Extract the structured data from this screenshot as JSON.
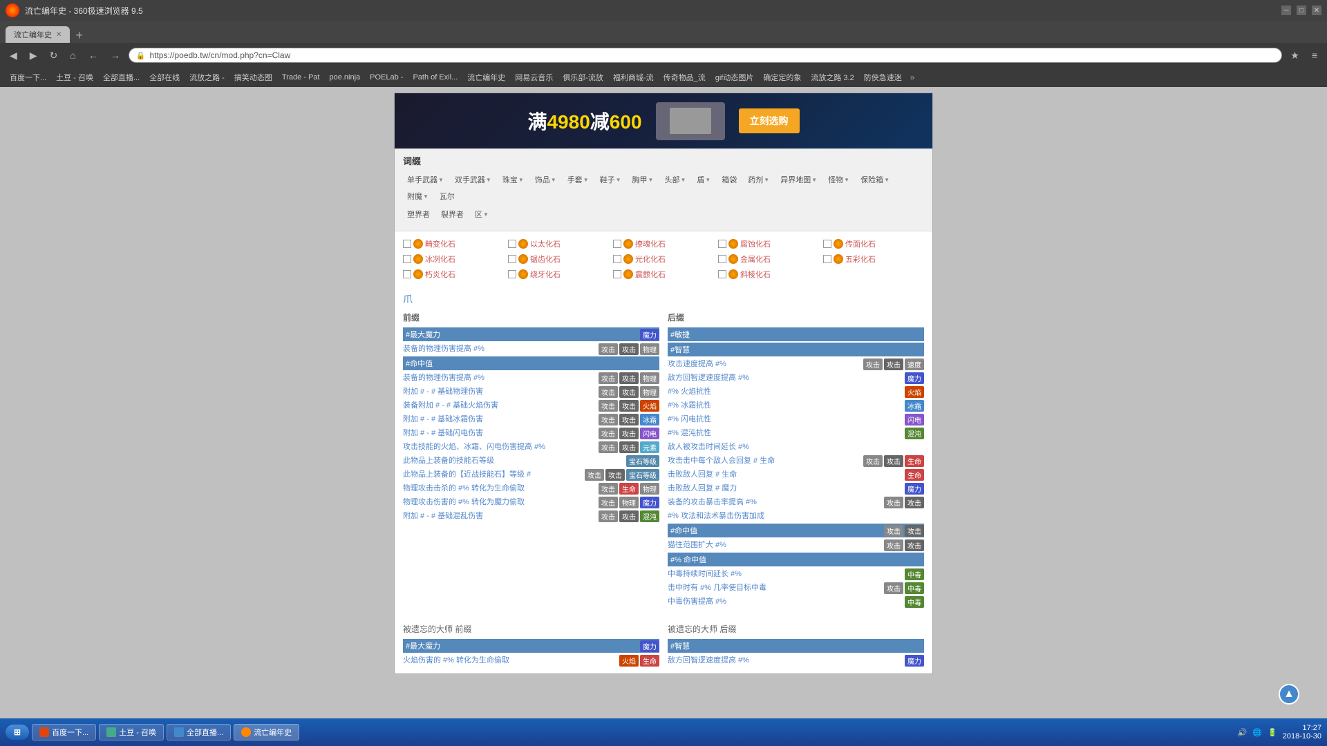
{
  "browser": {
    "title": "流亡编年史 - 360极速浏览器 9.5",
    "url": "https://poedb.tw/cn/mod.php?cn=Claw",
    "tab_label": "流亡编年史",
    "nav_buttons": [
      "◀",
      "▶",
      "↻",
      "⌂",
      "←",
      "→",
      "★"
    ],
    "bookmarks": [
      "百度一下...",
      "土豆 - 召唤",
      "全部直播...",
      "全部在线",
      "流放之路 -",
      "搞笑动态图",
      "Trade - Pat",
      "poe.ninja",
      "POELab -",
      "Path of Exil...",
      "流亡编年史",
      "网易云音乐",
      "俱乐部-流放",
      "福利商城-流",
      "传奇物品_流",
      "gif动态图片",
      "确定定的象",
      "流放之路 3.2",
      "防侠急速迷"
    ]
  },
  "banner": {
    "text": "满4980减600",
    "button": "立刻选购"
  },
  "menu": {
    "title": "词缀",
    "items_row1": [
      {
        "label": "单手武器",
        "has_dropdown": true
      },
      {
        "label": "双手武器",
        "has_dropdown": true
      },
      {
        "label": "珠宝",
        "has_dropdown": true
      },
      {
        "label": "饰品",
        "has_dropdown": true
      },
      {
        "label": "手套",
        "has_dropdown": true
      },
      {
        "label": "鞋子",
        "has_dropdown": true
      },
      {
        "label": "胸甲",
        "has_dropdown": true
      },
      {
        "label": "头部",
        "has_dropdown": true
      },
      {
        "label": "盾",
        "has_dropdown": true
      },
      {
        "label": "箱袋",
        "has_dropdown": false
      },
      {
        "label": "药剂",
        "has_dropdown": true
      },
      {
        "label": "异界地图",
        "has_dropdown": true
      },
      {
        "label": "怪物",
        "has_dropdown": true
      },
      {
        "label": "保险箱",
        "has_dropdown": true
      },
      {
        "label": "附魔",
        "has_dropdown": true
      },
      {
        "label": "瓦尔",
        "has_dropdown": false
      }
    ],
    "items_row2": [
      {
        "label": "塑界者",
        "has_dropdown": false
      },
      {
        "label": "裂界者",
        "has_dropdown": false
      },
      {
        "label": "区",
        "has_dropdown": true
      }
    ]
  },
  "gems": [
    {
      "name": "畸变化石",
      "color": "orange"
    },
    {
      "name": "以太化石",
      "color": "orange"
    },
    {
      "name": "撩魂化石",
      "color": "orange"
    },
    {
      "name": "腐蚀化石",
      "color": "orange"
    },
    {
      "name": "传面化石",
      "color": "orange"
    },
    {
      "name": "冰冽化石",
      "color": "orange"
    },
    {
      "name": "锯齿化石",
      "color": "orange"
    },
    {
      "name": "光化化石",
      "color": "orange"
    },
    {
      "name": "金属化石",
      "color": "orange"
    },
    {
      "name": "五彩化石",
      "color": "orange"
    },
    {
      "name": "朽炎化石",
      "color": "orange"
    },
    {
      "name": "绕牙化石",
      "color": "orange"
    },
    {
      "name": "震颤化石",
      "color": "orange"
    },
    {
      "name": "斜棱化石",
      "color": "orange"
    }
  ],
  "claw_icon": "爪",
  "prefix_title": "前缀",
  "suffix_title": "后缀",
  "prefix_rows": [
    {
      "label": "#最大魔力",
      "tags": [
        {
          "text": "魔力",
          "type": "mana"
        }
      ],
      "highlight": true
    },
    {
      "label": "装备的物理伤害提高 #%",
      "tags": [
        {
          "text": "攻击",
          "type": "atk"
        },
        {
          "text": "攻击",
          "type": "atk2"
        },
        {
          "text": "物理",
          "type": "phys"
        }
      ]
    },
    {
      "label": "#命中值",
      "tags": [],
      "highlight": true
    },
    {
      "label": "装备的物理伤害提高 #%",
      "tags": [
        {
          "text": "攻击",
          "type": "atk"
        },
        {
          "text": "攻击",
          "type": "atk2"
        },
        {
          "text": "物理",
          "type": "phys"
        }
      ]
    },
    {
      "label": "附加 # - # 基础物理伤害",
      "tags": [
        {
          "text": "攻击",
          "type": "atk"
        },
        {
          "text": "攻击",
          "type": "atk2"
        },
        {
          "text": "物理",
          "type": "phys"
        }
      ]
    },
    {
      "label": "装备附加 # - # 基础火焰伤害",
      "tags": [
        {
          "text": "攻击",
          "type": "atk"
        },
        {
          "text": "攻击",
          "type": "atk2"
        },
        {
          "text": "火焰",
          "type": "fire"
        }
      ]
    },
    {
      "label": "附加 # - # 基础冰霜伤害",
      "tags": [
        {
          "text": "攻击",
          "type": "atk"
        },
        {
          "text": "攻击",
          "type": "atk2"
        },
        {
          "text": "冰霜",
          "type": "ice"
        }
      ]
    },
    {
      "label": "附加 # - # 基础闪电伤害",
      "tags": [
        {
          "text": "攻击",
          "type": "atk"
        },
        {
          "text": "攻击",
          "type": "atk2"
        },
        {
          "text": "闪电",
          "type": "lightning"
        }
      ]
    },
    {
      "label": "攻击技能的火焰、冰霜、闪电伤害提高 #%",
      "tags": [
        {
          "text": "攻击",
          "type": "atk"
        },
        {
          "text": "攻击",
          "type": "atk2"
        },
        {
          "text": "元素",
          "type": "elem"
        }
      ]
    },
    {
      "label": "此物品上装备的技能石等级",
      "tags": [
        {
          "text": "宝石等级",
          "type": "gem"
        }
      ]
    },
    {
      "label": "此物品上装备的【近战技能石】等级 #",
      "tags": [
        {
          "text": "攻击",
          "type": "atk"
        },
        {
          "text": "攻击",
          "type": "atk2"
        },
        {
          "text": "宝石等级",
          "type": "gem"
        }
      ]
    },
    {
      "label": "物理攻击击杀的 #% 转化为生命偷取",
      "tags": [
        {
          "text": "攻击",
          "type": "atk"
        },
        {
          "text": "生命",
          "type": "life"
        },
        {
          "text": "物理",
          "type": "phys"
        }
      ]
    },
    {
      "label": "物理攻击伤害的 #% 转化为魔力偷取",
      "tags": [
        {
          "text": "攻击",
          "type": "atk"
        },
        {
          "text": "物理",
          "type": "phys"
        },
        {
          "text": "魔力",
          "type": "mana"
        }
      ]
    },
    {
      "label": "附加 # - # 基础混乱伤害",
      "tags": [
        {
          "text": "攻击",
          "type": "atk"
        },
        {
          "text": "攻击",
          "type": "atk2"
        },
        {
          "text": "混沌",
          "type": "poison"
        }
      ]
    }
  ],
  "suffix_rows": [
    {
      "label": "#敏捷",
      "tags": [],
      "highlight": true
    },
    {
      "label": "#智慧",
      "tags": [],
      "highlight": true
    },
    {
      "label": "攻击速度提高 #%",
      "tags": [
        {
          "text": "攻击",
          "type": "atk"
        },
        {
          "text": "攻击",
          "type": "atk2"
        },
        {
          "text": "速度",
          "type": "speed"
        }
      ]
    },
    {
      "label": "敌方回智逻速度提高 #%",
      "tags": [
        {
          "text": "魔力",
          "type": "mana"
        }
      ]
    },
    {
      "label": "#% 火焰抗性",
      "tags": [
        {
          "text": "火焰",
          "type": "fire"
        }
      ]
    },
    {
      "label": "#% 冰霜抗性",
      "tags": [
        {
          "text": "冰霜",
          "type": "ice"
        }
      ]
    },
    {
      "label": "#% 闪电抗性",
      "tags": [
        {
          "text": "闪电",
          "type": "lightning"
        }
      ]
    },
    {
      "label": "#% 混沌抗性",
      "tags": [
        {
          "text": "混沌",
          "type": "poison"
        }
      ]
    },
    {
      "label": "敌人被攻击时间延长 #%",
      "tags": []
    },
    {
      "label": "攻击击中每个敌人会回复 # 生命",
      "tags": [
        {
          "text": "攻击",
          "type": "atk"
        },
        {
          "text": "攻击",
          "type": "atk2"
        },
        {
          "text": "生命",
          "type": "life"
        }
      ]
    },
    {
      "label": "击败敌人回复 # 生命",
      "tags": [
        {
          "text": "生命",
          "type": "life"
        }
      ]
    },
    {
      "label": "击败敌人回复 # 魔力",
      "tags": [
        {
          "text": "魔力",
          "type": "mana"
        }
      ]
    },
    {
      "label": "装备的攻击暴击率提高 #%",
      "tags": [
        {
          "text": "攻击",
          "type": "atk"
        },
        {
          "text": "攻击",
          "type": "atk2"
        }
      ]
    },
    {
      "label": "#% 攻法和法术暴击伤害加成",
      "tags": []
    },
    {
      "label": "#命中值",
      "tags": [
        {
          "text": "攻击",
          "type": "atk"
        },
        {
          "text": "攻击",
          "type": "atk2"
        }
      ],
      "highlight": true
    },
    {
      "label": "猫往范围扩大 #%",
      "tags": [
        {
          "text": "攻击",
          "type": "atk"
        },
        {
          "text": "攻击",
          "type": "atk2"
        }
      ]
    },
    {
      "label": "#% 命中值",
      "tags": [],
      "highlight": true
    },
    {
      "label": "中毒持续时间延长 #%",
      "tags": [
        {
          "text": "中毒",
          "type": "poison"
        }
      ]
    },
    {
      "label": "击中时有 #% 几率使目标中毒",
      "tags": [
        {
          "text": "攻击",
          "type": "atk"
        },
        {
          "text": "中毒",
          "type": "poison"
        }
      ]
    },
    {
      "label": "中毒伤害提高 #%",
      "tags": [
        {
          "text": "中毒",
          "type": "poison"
        }
      ]
    }
  ],
  "forgotten_prefix_title": "被遗忘的大师 前缀",
  "forgotten_suffix_title": "被遗忘的大师 后缀",
  "forgotten_prefix_rows": [
    {
      "label": "#最大魔力",
      "tags": [
        {
          "text": "魔力",
          "type": "mana"
        }
      ],
      "highlight": true
    },
    {
      "label": "火焰伤害的 #% 转化为生命偷取",
      "tags": [
        {
          "text": "火焰",
          "type": "fire"
        },
        {
          "text": "生命",
          "type": "life"
        }
      ]
    }
  ],
  "forgotten_suffix_rows": [
    {
      "label": "#智慧",
      "tags": [],
      "highlight": true
    },
    {
      "label": "敌方回智逻速度提高 #%",
      "tags": [
        {
          "text": "魔力",
          "type": "mana"
        }
      ]
    }
  ],
  "taskbar": {
    "start_label": "开始",
    "items": [
      "百度一下...",
      "土豆 - 召唤",
      "全部直播...",
      "流亡编年史"
    ],
    "clock_time": "17:27",
    "clock_date": "2018-10-30"
  }
}
